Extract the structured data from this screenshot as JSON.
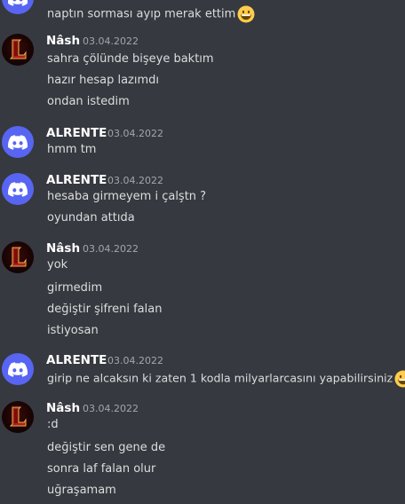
{
  "messages": [
    {
      "author": "",
      "timestamp": "",
      "avatar_icon": "discord-logo-icon",
      "lines": [
        "naptın sorması ayıp merak ettim"
      ],
      "emoji": "grinning-face-icon"
    },
    {
      "author": "Nâsh",
      "timestamp": "03.04.2022",
      "avatar_icon": "nash-logo-icon",
      "lines": [
        "sahra çölünde bişeye baktım",
        "hazır hesap lazımdı",
        "ondan istedim"
      ]
    },
    {
      "author": "ALRENTE",
      "timestamp": "03.04.2022",
      "avatar_icon": "discord-logo-icon",
      "lines": [
        "hmm tm"
      ]
    },
    {
      "author": "ALRENTE",
      "timestamp": "03.04.2022",
      "avatar_icon": "discord-logo-icon",
      "lines": [
        "hesaba girmeyem i çalştn ?",
        "oyundan attıda"
      ]
    },
    {
      "author": "Nâsh",
      "timestamp": "03.04.2022",
      "avatar_icon": "nash-logo-icon",
      "lines": [
        "yok",
        "girmedim",
        "değiştir şifreni falan",
        "istiyosan"
      ]
    },
    {
      "author": "ALRENTE",
      "timestamp": "03.04.2022",
      "avatar_icon": "discord-logo-icon",
      "lines": [
        "girip ne alcaksın ki zaten 1 kodla milyarlarcasını yapabilirsiniz"
      ],
      "emoji": "grinning-face-icon"
    },
    {
      "author": "Nâsh",
      "timestamp": "03.04.2022",
      "avatar_icon": "nash-logo-icon",
      "lines": [
        ":d",
        "değiştir sen gene de",
        "sonra laf falan olur",
        "uğraşamam"
      ]
    }
  ],
  "colors": {
    "background": "#36393f",
    "author": "#ffffff",
    "message_text": "#dcddde",
    "timestamp": "#a3a6aa",
    "discord_blurple": "#5865f2"
  }
}
